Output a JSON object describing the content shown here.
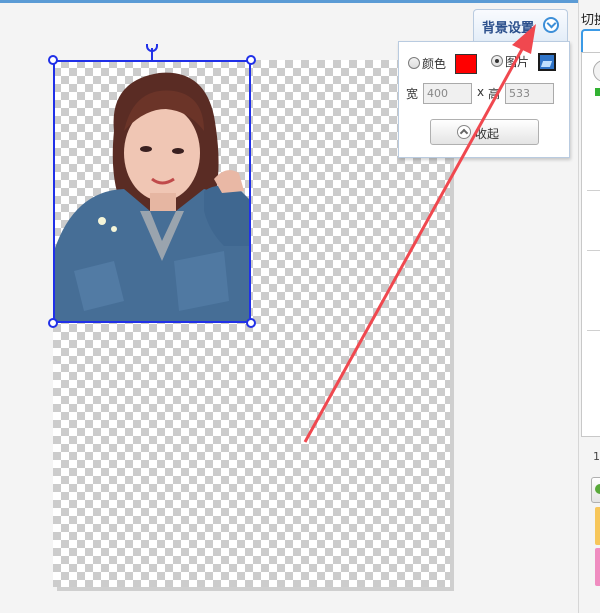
{
  "colors": {
    "selection": "#2030e8",
    "arrow": "#f0484f",
    "swatch": "#ff0000",
    "tab_text": "#2b4f8c"
  },
  "background_settings": {
    "tab_label": "背景设置",
    "tab_icon": "chevron-down-icon",
    "color_option_label": "颜色",
    "color_selected": false,
    "image_option_label": "图片",
    "image_selected": true,
    "width_label": "宽",
    "width_value": "400",
    "times_label": "x",
    "height_label": "高",
    "height_value": "533",
    "collapse_label": "收起",
    "collapse_icon": "chevron-up-icon"
  },
  "sidebar": {
    "title": "切换",
    "page_number": "1"
  }
}
